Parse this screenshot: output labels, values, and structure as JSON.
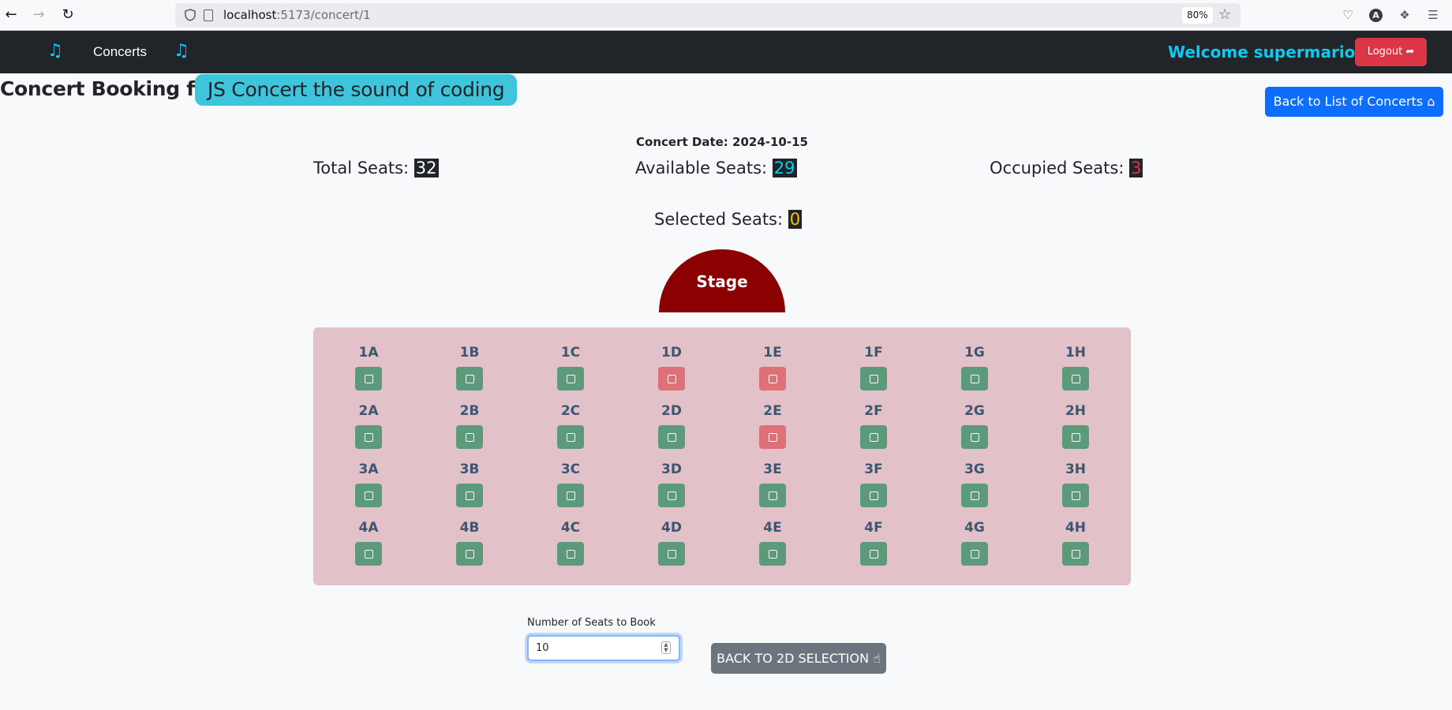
{
  "browser": {
    "url_host": "localhost",
    "url_path": ":5173/concert/1",
    "zoom": "80%"
  },
  "navbar": {
    "link_label": "Concerts",
    "welcome": "Welcome supermario",
    "logout_label": "Logout",
    "accent_color": "#0dcaf0"
  },
  "header": {
    "title": "Concert Booking for:",
    "concert_name": "JS Concert the sound of coding",
    "back_button": "Back to List of Concerts"
  },
  "summary": {
    "concert_date": "Concert Date: 2024-10-15",
    "total_label": "Total Seats:",
    "total_value": "32",
    "available_label": "Available Seats:",
    "available_value": "29",
    "occupied_label": "Occupied Seats:",
    "occupied_value": "3",
    "selected_label": "Selected Seats:",
    "selected_value": "0"
  },
  "stage": {
    "label": "Stage"
  },
  "seats": {
    "columns": [
      "A",
      "B",
      "C",
      "D",
      "E",
      "F",
      "G",
      "H"
    ],
    "rows": [
      "1",
      "2",
      "3",
      "4"
    ],
    "occupied": [
      "1D",
      "1E",
      "2E"
    ],
    "colors": {
      "available": "#5b9a7a",
      "occupied": "#e07078"
    }
  },
  "form": {
    "num_label": "Number of Seats to Book",
    "num_value": "10",
    "back_2d_label": "BACK TO 2D SELECTION"
  }
}
